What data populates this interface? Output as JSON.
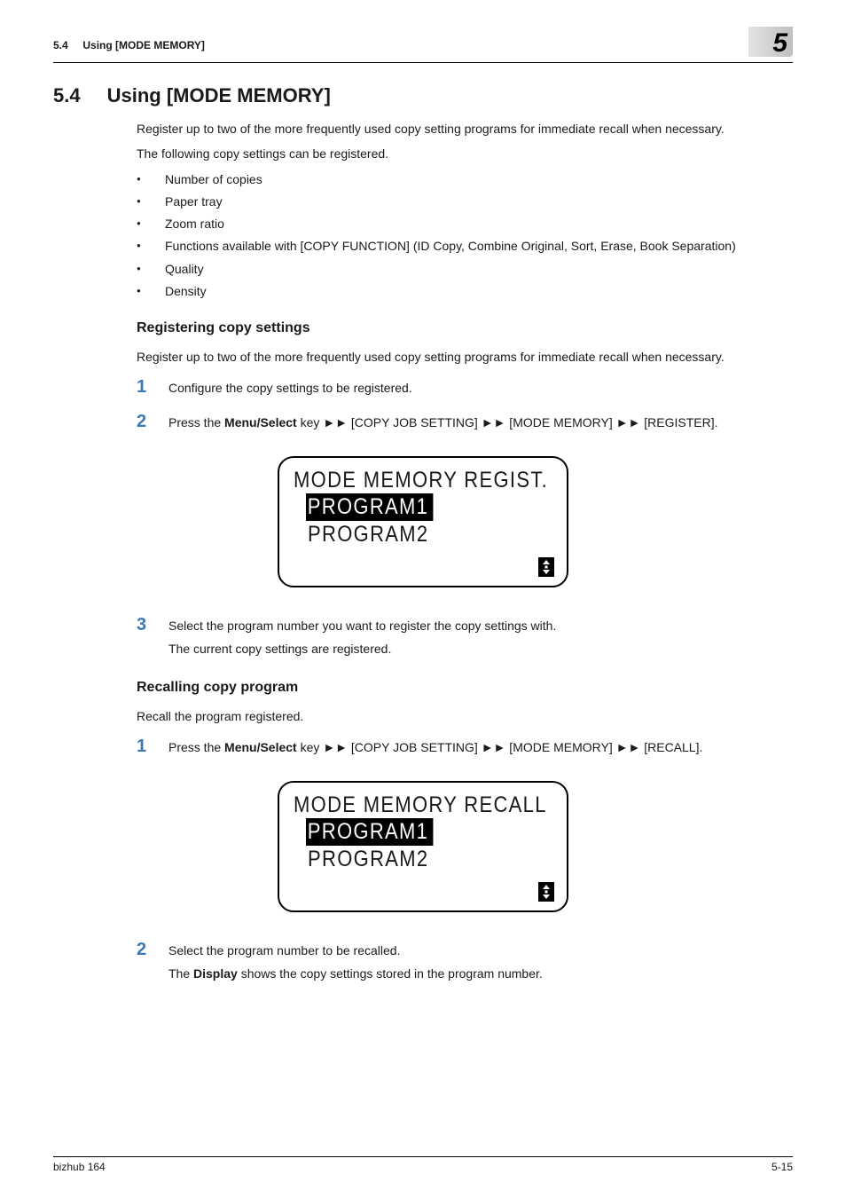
{
  "header": {
    "section_label": "5.4",
    "section_title_top": "Using [MODE MEMORY]",
    "chapter_num": "5"
  },
  "section": {
    "number": "5.4",
    "title": "Using [MODE MEMORY]"
  },
  "intro": {
    "line1": "Register up to two of the more frequently used copy setting programs for immediate recall when necessary.",
    "line2": "The following copy settings can be registered.",
    "bullets": [
      "Number of copies",
      "Paper tray",
      "Zoom ratio",
      "Functions available with [COPY FUNCTION] (ID Copy, Combine Original, Sort, Erase, Book Separation)",
      "Quality",
      "Density"
    ]
  },
  "register": {
    "heading": "Registering copy settings",
    "desc": "Register up to two of the more frequently used copy setting programs for immediate recall when necessary.",
    "steps": [
      {
        "n": "1",
        "body": "Configure the copy settings to be registered."
      },
      {
        "n": "2",
        "prefix": "Press the ",
        "key": "Menu/Select",
        "suffix": " key ",
        "arrow": "►►",
        "path1": " [COPY JOB SETTING] ",
        "path2": " [MODE MEMORY] ",
        "path3": " [REGISTER]."
      },
      {
        "n": "3",
        "body": "Select the program number you want to register the copy settings with.",
        "body2": "The current copy settings are registered."
      }
    ],
    "lcd": {
      "title": "MODE MEMORY REGIST.",
      "selected": "PROGRAM1",
      "other": "PROGRAM2"
    }
  },
  "recall": {
    "heading": "Recalling copy program",
    "desc": "Recall the program registered.",
    "steps": [
      {
        "n": "1",
        "prefix": "Press the ",
        "key": "Menu/Select",
        "suffix": " key ",
        "arrow": "►►",
        "path1": " [COPY JOB SETTING] ",
        "path2": " [MODE MEMORY] ",
        "path3": " [RECALL]."
      },
      {
        "n": "2",
        "body": "Select the program number to be recalled.",
        "prefix2": "The ",
        "key2": "Display",
        "suffix2": " shows the copy settings stored in the program number."
      }
    ],
    "lcd": {
      "title": "MODE MEMORY RECALL",
      "selected": "PROGRAM1",
      "other": "PROGRAM2"
    }
  },
  "footer": {
    "left": "bizhub 164",
    "right": "5-15"
  }
}
